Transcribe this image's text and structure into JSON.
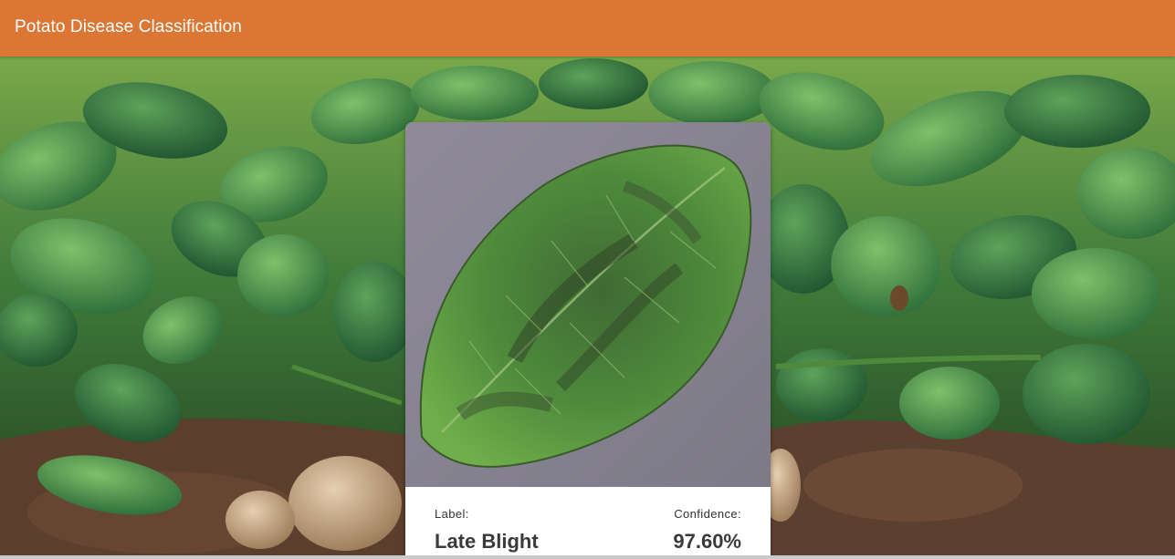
{
  "appbar": {
    "title": "Potato Disease Classification"
  },
  "result": {
    "label_caption": "Label:",
    "label_value": "Late Blight",
    "confidence_caption": "Confidence:",
    "confidence_value": "97.60%"
  },
  "colors": {
    "appbar": "#dc7634",
    "card_background": "#ffffff",
    "text_primary": "#3a3a3a"
  },
  "icons": {
    "background": "potato-field-image",
    "uploaded_image": "diseased-potato-leaf-image"
  }
}
